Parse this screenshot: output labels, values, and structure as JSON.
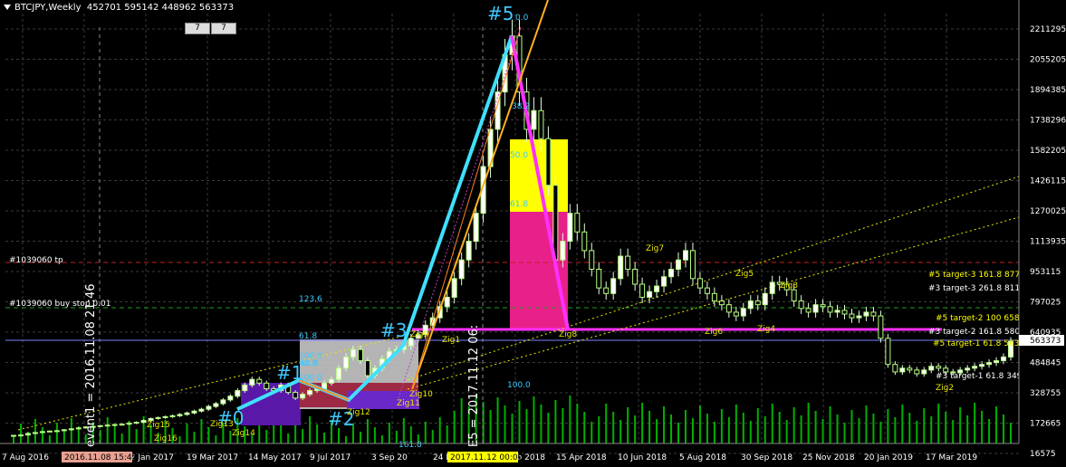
{
  "header": {
    "symbol": "BTCJPY,Weekly",
    "ohlc": "452701 595142 448962 563373"
  },
  "buttons": [
    "7",
    "7"
  ],
  "chart_data": {
    "type": "candlestick",
    "symbol": "BTCJPY",
    "timeframe": "Weekly",
    "ylim": [
      16575,
      2320000
    ],
    "price_scale": [
      "2211295",
      "2055205",
      "1894385",
      "1738296",
      "1582205",
      "1426115",
      "1270025",
      "1113935",
      "953115",
      "797025",
      "640935",
      "484845",
      "328755",
      "172665",
      "16575"
    ],
    "date_scale": [
      "7 Aug 2016",
      "Nov 2016",
      "22 Jan 2017",
      "19 Mar 2017",
      "14 May 2017",
      "9 Jul 2017",
      "3 Sep 20",
      "24 Dec 2017",
      "18 Feb 2018",
      "15 Apr 2018",
      "10 Jun 2018",
      "5 Aug 2018",
      "30 Sep 2018",
      "25 Nov 2018",
      "20 Jan 2019",
      "17 Mar 2019"
    ],
    "date_highlights": [
      "2016.11.08 15:45",
      "2017.11.12 00:00"
    ],
    "current_price": "563373",
    "vertical_labels": [
      "event1 = 2016.11.08 21:46",
      "E5 = 2017.11.12 06:"
    ],
    "horizontal_labels": [
      "#1039060 tp",
      "#1039060 buy stop 0.01"
    ],
    "targets": [
      "#5 target-3 161.8 877036",
      "#3 target-3 261.8 811796",
      "#5 target-2 100 658359",
      "#3 target-2 161.8 580682",
      "#5 target-1 61.8 563189",
      "#3 target-1 61.8 349568"
    ],
    "wave_labels": [
      "#0",
      "#1",
      "#2",
      "#3",
      "#5"
    ],
    "wave_points": [
      {
        "label": "#0",
        "price": 200000
      },
      {
        "label": "#1",
        "price": 355000
      },
      {
        "label": "#2",
        "price": 250000
      },
      {
        "label": "#3",
        "price": 540000
      },
      {
        "label": "#5",
        "price": 2200000
      }
    ],
    "zigzag_labels": [
      "Zig14",
      "Zig13",
      "Zig12",
      "Zig11",
      "Zig10",
      "Zig9",
      "Zig8",
      "Zig7",
      "Zig6",
      "Zig5",
      "Zig4",
      "Zig3",
      "Zig2",
      "Zig1",
      "Zig16",
      "Zig15"
    ],
    "fib_labels": [
      "0.0",
      "38.2",
      "50.0",
      "61.8",
      "100.0",
      "161.8",
      "123.6",
      "61.8",
      "100.0",
      "61.8",
      "100.0",
      "61.8"
    ],
    "closes": [
      60000,
      62000,
      70000,
      75000,
      80000,
      83000,
      85000,
      90000,
      95000,
      100000,
      105000,
      108000,
      112000,
      115000,
      118000,
      120000,
      125000,
      130000,
      140000,
      150000,
      155000,
      160000,
      165000,
      172000,
      180000,
      190000,
      200000,
      215000,
      230000,
      250000,
      270000,
      300000,
      330000,
      360000,
      340000,
      310000,
      300000,
      330000,
      290000,
      260000,
      280000,
      300000,
      310000,
      340000,
      360000,
      420000,
      480000,
      520000,
      460000,
      380000,
      420000,
      470000,
      510000,
      520000,
      540000,
      580000,
      600000,
      650000,
      690000,
      750000,
      800000,
      900000,
      1000000,
      1100000,
      1250000,
      1500000,
      1700000,
      1900000,
      2100000,
      2200000,
      1900000,
      1700000,
      1800000,
      1650000,
      1400000,
      1000000,
      1100000,
      1250000,
      1150000,
      1050000,
      950000,
      850000,
      820000,
      900000,
      1020000,
      950000,
      870000,
      800000,
      830000,
      860000,
      910000,
      950000,
      1000000,
      1050000,
      900000,
      850000,
      820000,
      780000,
      760000,
      720000,
      700000,
      740000,
      780000,
      760000,
      820000,
      880000,
      870000,
      840000,
      780000,
      740000,
      720000,
      760000,
      750000,
      720000,
      730000,
      710000,
      690000,
      700000,
      720000,
      700000,
      580000,
      440000,
      400000,
      420000,
      410000,
      390000,
      410000,
      430000,
      420000,
      400000,
      395000,
      410000,
      420000,
      430000,
      440000,
      450000,
      460000,
      480000,
      563373
    ]
  }
}
